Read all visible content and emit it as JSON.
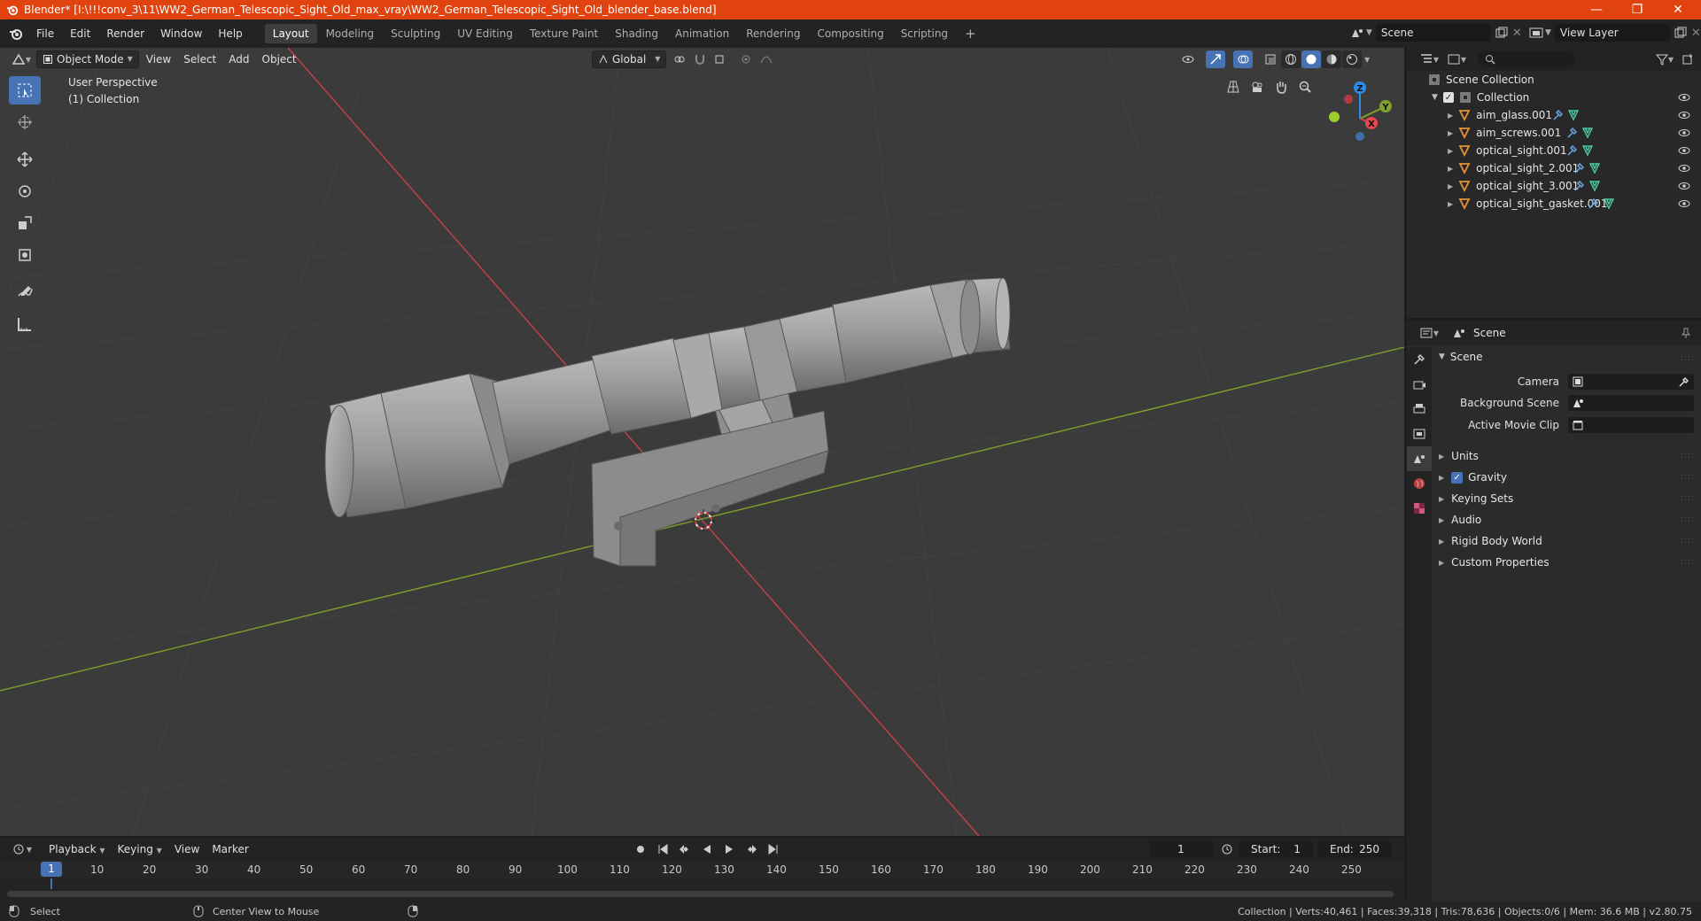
{
  "window": {
    "title": "Blender* [I:\\!!!conv_3\\11\\WW2_German_Telescopic_Sight_Old_max_vray\\WW2_German_Telescopic_Sight_Old_blender_base.blend]",
    "controls": [
      "minimize",
      "restore",
      "close"
    ]
  },
  "menubar": {
    "items": [
      "File",
      "Edit",
      "Render",
      "Window",
      "Help"
    ],
    "workspaces": [
      "Layout",
      "Modeling",
      "Sculpting",
      "UV Editing",
      "Texture Paint",
      "Shading",
      "Animation",
      "Rendering",
      "Compositing",
      "Scripting"
    ],
    "active_workspace": "Layout",
    "add_tab": "+",
    "scene": "Scene",
    "view_layer": "View Layer"
  },
  "viewport": {
    "mode": "Object Mode",
    "menus": [
      "View",
      "Select",
      "Add",
      "Object"
    ],
    "transform_orientation": "Global",
    "view_name": "User Perspective",
    "collection_label": "(1) Collection",
    "gizmo_axes": [
      "X",
      "Y",
      "Z"
    ],
    "tools": [
      "select-box",
      "cursor",
      "move",
      "rotate",
      "scale",
      "transform",
      "annotate",
      "measure"
    ]
  },
  "outliner": {
    "search_placeholder": "",
    "root": "Scene Collection",
    "collection": "Collection",
    "objects": [
      "aim_glass.001",
      "aim_screws.001",
      "optical_sight.001",
      "optical_sight_2.001",
      "optical_sight_3.001",
      "optical_sight_gasket.001"
    ]
  },
  "properties": {
    "header": "Scene",
    "section": "Scene",
    "fields": [
      {
        "label": "Camera",
        "value": ""
      },
      {
        "label": "Background Scene",
        "value": ""
      },
      {
        "label": "Active Movie Clip",
        "value": ""
      }
    ],
    "panels": [
      "Units",
      "Gravity",
      "Keying Sets",
      "Audio",
      "Rigid Body World",
      "Custom Properties"
    ],
    "gravity_checked": true
  },
  "timeline": {
    "menus": [
      "Playback",
      "Keying",
      "View",
      "Marker"
    ],
    "current_frame": "1",
    "start_label": "Start:",
    "start": "1",
    "end_label": "End:",
    "end": "250",
    "ticks": [
      "10",
      "20",
      "30",
      "40",
      "50",
      "60",
      "70",
      "80",
      "90",
      "100",
      "110",
      "120",
      "130",
      "140",
      "150",
      "160",
      "170",
      "180",
      "190",
      "200",
      "210",
      "220",
      "230",
      "240",
      "250"
    ],
    "playhead_label": "1"
  },
  "statusbar": {
    "select": "Select",
    "center_view": "Center View to Mouse",
    "stats": "Collection | Verts:40,461 | Faces:39,318 | Tris:78,636 | Objects:0/6 | Mem: 36.6 MB | v2.80.75"
  },
  "colors": {
    "titlebar": "#e0430f",
    "accent": "#4772b3",
    "x_axis": "#c8414b",
    "y_axis": "#7ea12a",
    "object_icon": "#e8913a"
  }
}
